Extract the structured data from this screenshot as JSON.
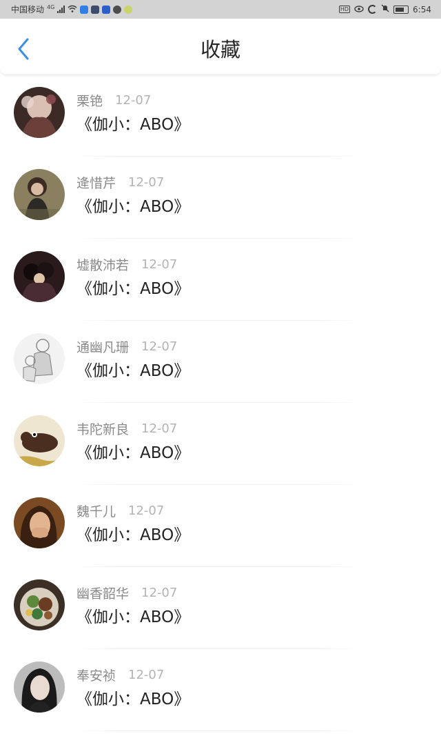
{
  "status_bar": {
    "carrier": "中国移动",
    "network": "4G",
    "time": "6:54",
    "left_icons": [
      "signal-icon",
      "wifi-icon",
      "app-icon-blue",
      "app-icon-dark",
      "app-icon-dark-2",
      "chat-bubble-icon",
      "emoji-icon"
    ],
    "right_icons": [
      "hd-icon",
      "eye-icon",
      "moon-icon",
      "mute-icon",
      "battery-icon"
    ],
    "hd_label": "HD"
  },
  "header": {
    "title": "收藏",
    "back_icon": "chevron-left-icon",
    "accent_color": "#3a8fe8"
  },
  "items": [
    {
      "name": "栗铯",
      "date": "12-07",
      "content": "《伽小：ABO》",
      "avatar_icon": "avatar-photo-1"
    },
    {
      "name": "逄惜芹",
      "date": "12-07",
      "content": "《伽小：ABO》",
      "avatar_icon": "avatar-photo-2"
    },
    {
      "name": "墟散沛若",
      "date": "12-07",
      "content": "《伽小：ABO》",
      "avatar_icon": "avatar-photo-3"
    },
    {
      "name": "通幽凡珊",
      "date": "12-07",
      "content": "《伽小：ABO》",
      "avatar_icon": "avatar-photo-4"
    },
    {
      "name": "韦陀新良",
      "date": "12-07",
      "content": "《伽小：ABO》",
      "avatar_icon": "avatar-photo-5"
    },
    {
      "name": "魏千儿",
      "date": "12-07",
      "content": "《伽小：ABO》",
      "avatar_icon": "avatar-photo-6"
    },
    {
      "name": "幽香韶华",
      "date": "12-07",
      "content": "《伽小：ABO》",
      "avatar_icon": "avatar-photo-7"
    },
    {
      "name": "奉安祯",
      "date": "12-07",
      "content": "《伽小：ABO》",
      "avatar_icon": "avatar-photo-8"
    }
  ]
}
